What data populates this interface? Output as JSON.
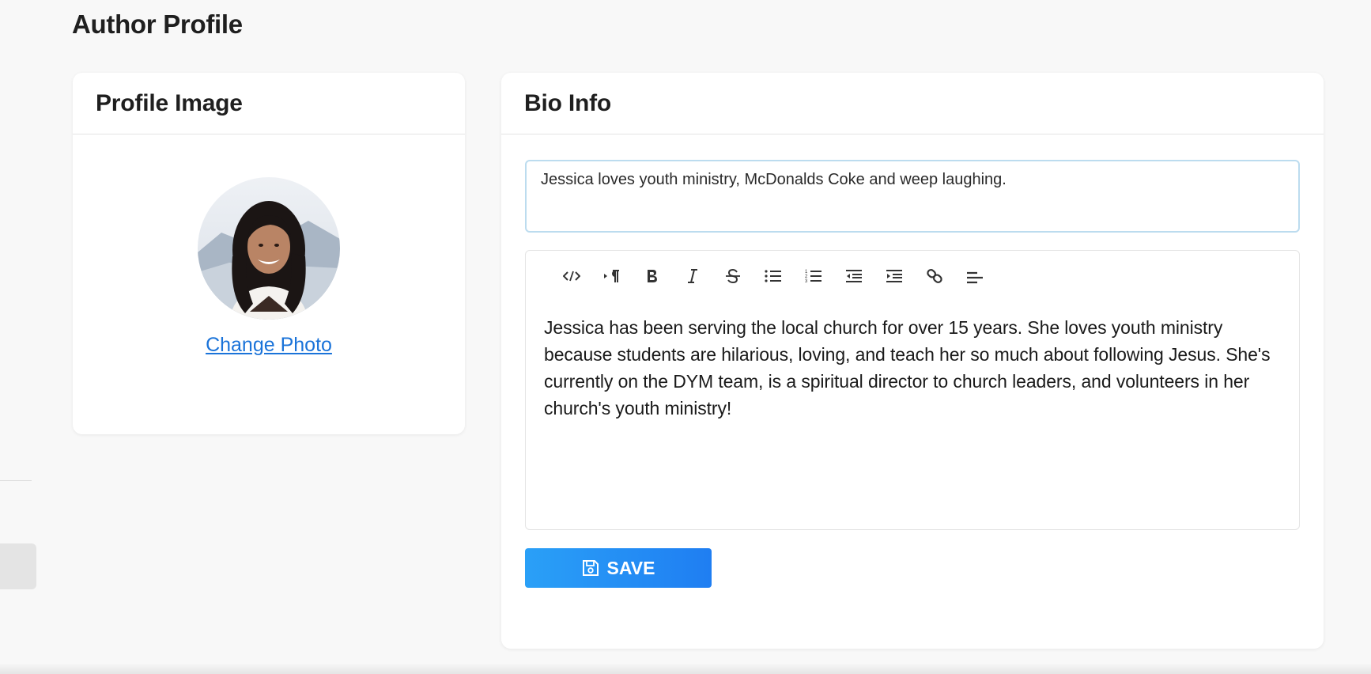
{
  "page": {
    "title": "Author Profile"
  },
  "profile_card": {
    "title": "Profile Image",
    "change_photo_label": "Change Photo"
  },
  "bio_card": {
    "title": "Bio Info",
    "tagline_value": "Jessica loves youth ministry, McDonalds Coke and weep laughing.",
    "toolbar": [
      {
        "name": "code-view-icon"
      },
      {
        "name": "paragraph-icon"
      },
      {
        "name": "bold-icon"
      },
      {
        "name": "italic-icon"
      },
      {
        "name": "strikethrough-icon"
      },
      {
        "name": "bullet-list-icon"
      },
      {
        "name": "numbered-list-icon"
      },
      {
        "name": "outdent-icon"
      },
      {
        "name": "indent-icon"
      },
      {
        "name": "link-icon"
      },
      {
        "name": "align-icon"
      }
    ],
    "bio_text": "Jessica has been serving the local church for over 15 years. She loves youth ministry because students are hilarious, loving, and teach her so much about following Jesus. She's currently on the DYM team, is a spiritual director to church leaders, and volunteers in her church's youth ministry!",
    "save_label": "SAVE"
  },
  "colors": {
    "accent": "#1f7ef2",
    "link": "#1a73d9",
    "background": "#f8f8f8"
  }
}
